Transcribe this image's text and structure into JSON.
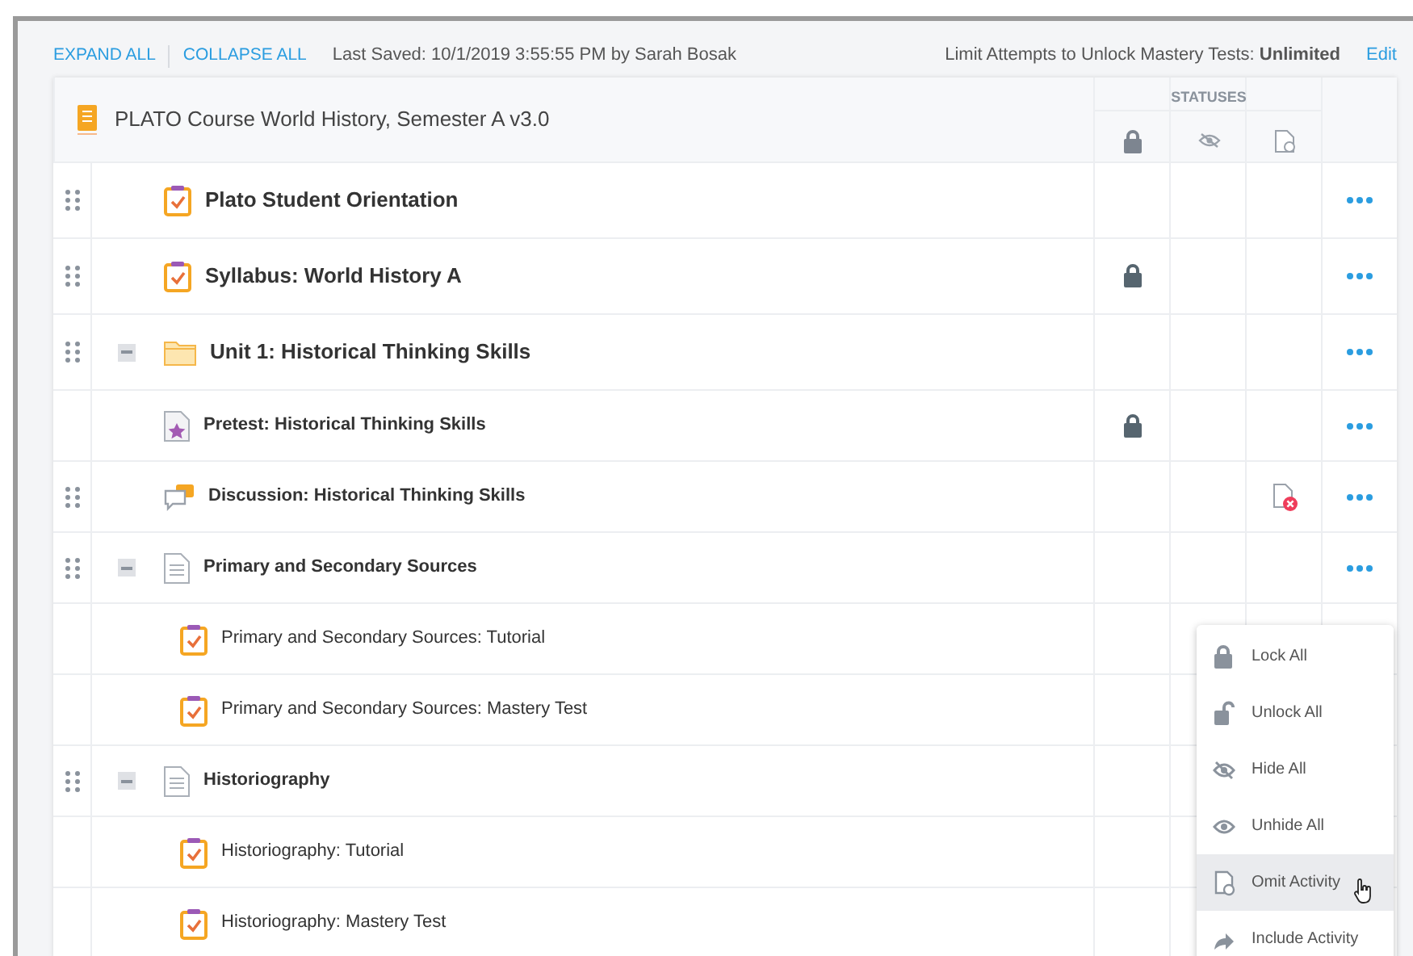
{
  "toolbar": {
    "expand_all": "EXPAND ALL",
    "collapse_all": "COLLAPSE ALL",
    "last_saved": "Last Saved: 10/1/2019 3:55:55 PM by Sarah Bosak",
    "limit": "Limit Attempts to Unlock Mastery Tests: **Unlimited**",
    "edit": "Edit"
  },
  "course": {
    "title": "PLATO Course World History, Semester A v3.0",
    "statuses_label": "STATUSES"
  },
  "items": [
    {
      "title": "Plato Student Orientation",
      "kind": "activity",
      "draggable": true,
      "locked": false,
      "omitted": false
    },
    {
      "title": "Syllabus: World History A",
      "kind": "activity",
      "draggable": true,
      "locked": true,
      "omitted": false
    },
    {
      "title": "Unit 1: Historical Thinking Skills",
      "kind": "folder",
      "draggable": true,
      "expanded": true,
      "locked": false,
      "omitted": false,
      "children": [
        {
          "title": "Pretest: Historical Thinking Skills",
          "kind": "test",
          "draggable": false,
          "locked": true,
          "omitted": false
        },
        {
          "title": "Discussion: Historical Thinking Skills",
          "kind": "discussion",
          "draggable": true,
          "locked": false,
          "omitted": true
        },
        {
          "title": "Primary and Secondary Sources",
          "kind": "document",
          "draggable": true,
          "expanded": true,
          "locked": false,
          "omitted": false,
          "children": [
            {
              "title": "Primary and Secondary Sources: Tutorial",
              "kind": "activity",
              "draggable": false,
              "locked": false,
              "omitted": false
            },
            {
              "title": "Primary and Secondary Sources: Mastery Test",
              "kind": "activity",
              "draggable": false,
              "locked": false,
              "omitted": false
            }
          ]
        },
        {
          "title": "Historiography",
          "kind": "document",
          "draggable": true,
          "expanded": true,
          "locked": false,
          "omitted": false,
          "children": [
            {
              "title": "Historiography: Tutorial",
              "kind": "activity",
              "draggable": false,
              "locked": false,
              "omitted": false
            },
            {
              "title": "Historiography: Mastery Test",
              "kind": "activity",
              "draggable": false,
              "locked": false,
              "omitted": false
            }
          ]
        }
      ]
    }
  ],
  "menu": [
    {
      "label": "Lock All",
      "kind": "lock",
      "selected": false
    },
    {
      "label": "Unlock All",
      "kind": "unlock",
      "selected": false
    },
    {
      "label": "Hide All",
      "kind": "hide",
      "selected": false
    },
    {
      "label": "Unhide All",
      "kind": "unhide",
      "selected": false
    },
    {
      "label": "Omit Activity",
      "kind": "omit",
      "selected": true
    },
    {
      "label": "Include Activity",
      "kind": "include",
      "selected": false
    }
  ]
}
